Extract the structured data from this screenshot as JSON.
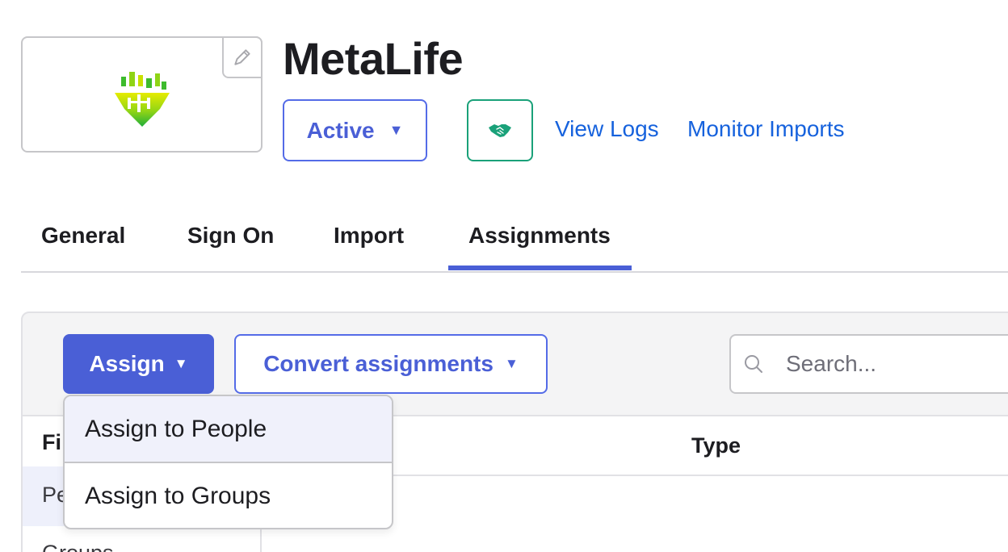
{
  "app": {
    "title": "MetaLife",
    "status_label": "Active",
    "links": [
      "View Logs",
      "Monitor Imports"
    ]
  },
  "tabs": [
    {
      "label": "General",
      "active": false
    },
    {
      "label": "Sign On",
      "active": false
    },
    {
      "label": "Import",
      "active": false
    },
    {
      "label": "Assignments",
      "active": true
    }
  ],
  "toolbar": {
    "assign_label": "Assign",
    "convert_label": "Convert assignments",
    "search_placeholder": "Search..."
  },
  "dropdown": {
    "items": [
      "Assign to People",
      "Assign to Groups"
    ]
  },
  "filters": {
    "heading": "Fi",
    "items": [
      "Pe",
      "Groups"
    ]
  },
  "table": {
    "columns": [
      "Type"
    ]
  },
  "colors": {
    "primary": "#4a5fd6",
    "link": "#1662dd",
    "success": "#1aa179",
    "logo_green": "#3dbb2d",
    "logo_yellow": "#c8e000"
  },
  "icons": {
    "edit": "pencil-icon",
    "integration": "handshake-icon",
    "search": "search-icon",
    "caret": "caret-down-icon"
  }
}
